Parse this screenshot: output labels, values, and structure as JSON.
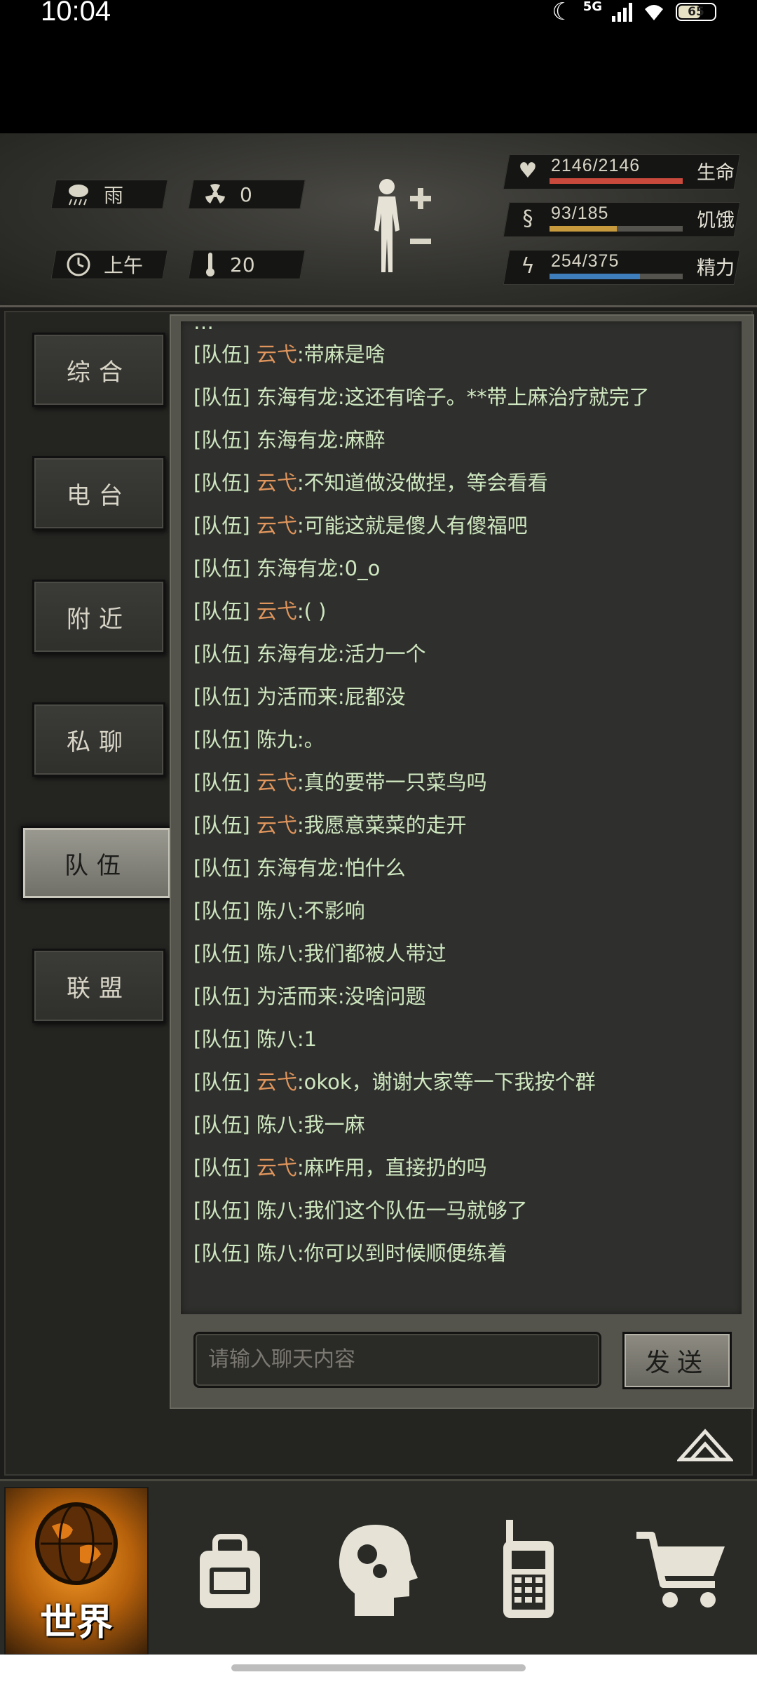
{
  "status_bar": {
    "time": "10:04",
    "network": "5G",
    "battery": "65",
    "battery_level": 0.65
  },
  "hud": {
    "weather": "雨",
    "radiation": "0",
    "time_of_day": "上午",
    "temperature": "20",
    "stats": [
      {
        "key": "life",
        "value": "2146/2146",
        "label": "生命",
        "fraction": 1.0,
        "color": "#c94a3c"
      },
      {
        "key": "hunger",
        "value": "93/185",
        "label": "饥饿",
        "fraction": 0.503,
        "color": "#c89a3e"
      },
      {
        "key": "energy",
        "value": "254/375",
        "label": "精力",
        "fraction": 0.677,
        "color": "#3f7ebd"
      }
    ]
  },
  "tabs": [
    {
      "label": "综合",
      "active": false
    },
    {
      "label": "电台",
      "active": false
    },
    {
      "label": "附近",
      "active": false
    },
    {
      "label": "私聊",
      "active": false
    },
    {
      "label": "队伍",
      "active": true
    },
    {
      "label": "联盟",
      "active": false
    }
  ],
  "chat": {
    "channel_tag": "[队伍]",
    "messages": [
      {
        "name": "云弋",
        "highlight": true,
        "text": ":带麻是啥"
      },
      {
        "name": "东海有龙",
        "highlight": false,
        "text": ":这还有啥子。**带上麻治疗就完了"
      },
      {
        "name": "东海有龙",
        "highlight": false,
        "text": ":麻醉"
      },
      {
        "name": "云弋",
        "highlight": true,
        "text": ":不知道做没做捏，等会看看"
      },
      {
        "name": "云弋",
        "highlight": true,
        "text": ":可能这就是傻人有傻福吧"
      },
      {
        "name": "东海有龙",
        "highlight": false,
        "text": ":0_o"
      },
      {
        "name": "云弋",
        "highlight": true,
        "text": ":(                    )"
      },
      {
        "name": "东海有龙",
        "highlight": false,
        "text": ":活力一个"
      },
      {
        "name": "为活而来",
        "highlight": false,
        "text": ":屁都没"
      },
      {
        "name": "陈九",
        "highlight": false,
        "text": ":。"
      },
      {
        "name": "云弋",
        "highlight": true,
        "text": ":真的要带一只菜鸟吗"
      },
      {
        "name": "云弋",
        "highlight": true,
        "text": ":我愿意菜菜的走开"
      },
      {
        "name": "东海有龙",
        "highlight": false,
        "text": ":怕什么"
      },
      {
        "name": "陈八",
        "highlight": false,
        "text": ":不影响"
      },
      {
        "name": "陈八",
        "highlight": false,
        "text": ":我们都被人带过"
      },
      {
        "name": "为活而来",
        "highlight": false,
        "text": ":没啥问题"
      },
      {
        "name": "陈八",
        "highlight": false,
        "text": ":1"
      },
      {
        "name": "云弋",
        "highlight": true,
        "text": ":okok，谢谢大家等一下我按个群"
      },
      {
        "name": "陈八",
        "highlight": false,
        "text": ":我一麻"
      },
      {
        "name": "云弋",
        "highlight": true,
        "text": ":麻咋用，直接扔的吗"
      },
      {
        "name": "陈八",
        "highlight": false,
        "text": ":我们这个队伍一马就够了"
      },
      {
        "name": "陈八",
        "highlight": false,
        "text": ":你可以到时候顺便练着"
      }
    ],
    "input_placeholder": "请输入聊天内容",
    "send_label": "发送"
  },
  "bottom_nav": {
    "world_label": "世界",
    "items": [
      "globe-icon",
      "backpack-icon",
      "skills-head-icon",
      "radio-walkie-icon",
      "shopping-cart-icon"
    ]
  }
}
